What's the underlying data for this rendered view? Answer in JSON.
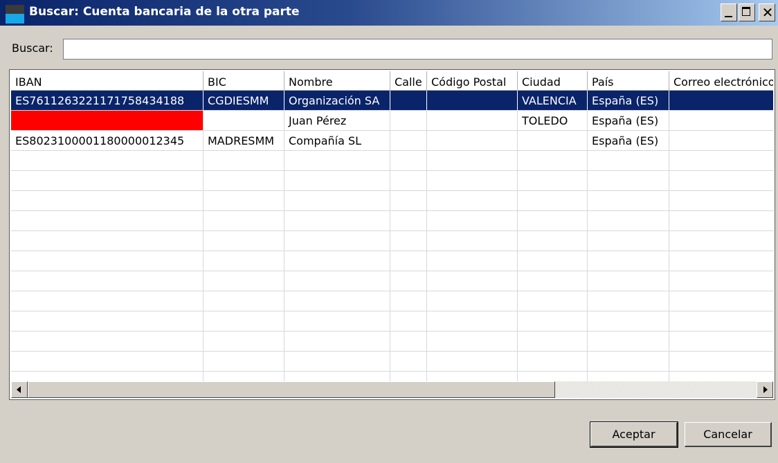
{
  "window": {
    "title": "Buscar: Cuenta bancaria de la otra parte",
    "controls": {
      "minimize": "_",
      "maximize": "□",
      "close": "✕"
    },
    "colors": {
      "title_start": "#0a246a",
      "title_end": "#a6caf0",
      "selection": "#0a246a",
      "highlight_red": "#ff0000"
    }
  },
  "search": {
    "label": "Buscar:",
    "value": "",
    "placeholder": ""
  },
  "table": {
    "columns": [
      "IBAN",
      "BIC",
      "Nombre",
      "Calle",
      "Código Postal",
      "Ciudad",
      "País",
      "Correo electrónico"
    ],
    "rows": [
      {
        "iban": "ES7611263221171758434188",
        "bic": "CGDIESMM",
        "nombre": "Organización SA",
        "calle": "",
        "cp": "",
        "ciudad": "VALENCIA",
        "pais": "España (ES)",
        "email": "",
        "selected": true,
        "iban_highlight": false
      },
      {
        "iban": "",
        "bic": "",
        "nombre": "Juan Pérez",
        "calle": "",
        "cp": "",
        "ciudad": "TOLEDO",
        "pais": "España (ES)",
        "email": "",
        "selected": false,
        "iban_highlight": true
      },
      {
        "iban": "ES8023100001180000012345",
        "bic": "MADRESMM",
        "nombre": "Compañía SL",
        "calle": "",
        "cp": "",
        "ciudad": "",
        "pais": "España (ES)",
        "email": "",
        "selected": false,
        "iban_highlight": false
      }
    ]
  },
  "buttons": {
    "ok": "Aceptar",
    "cancel": "Cancelar"
  }
}
